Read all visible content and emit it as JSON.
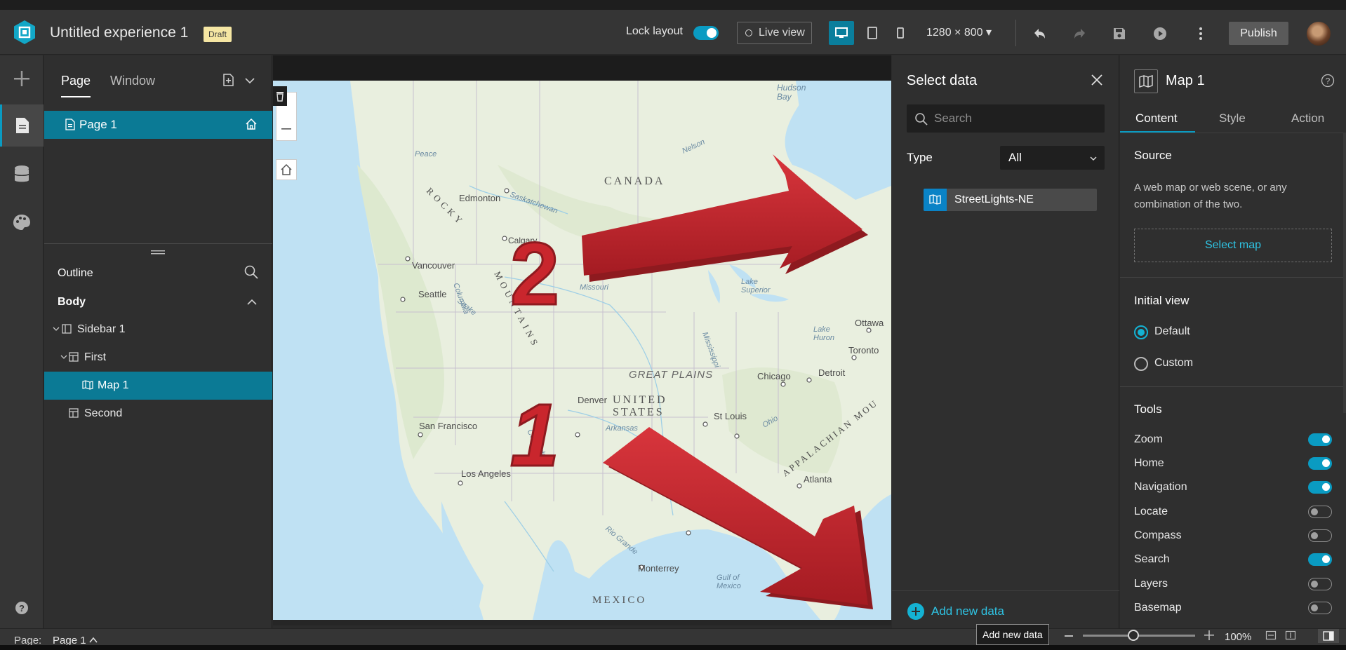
{
  "header": {
    "app_title": "Untitled experience 1",
    "draft_badge": "Draft",
    "lock_layout_label": "Lock layout",
    "lock_layout_on": true,
    "live_view_label": "Live view",
    "resolution": "1280 × 800",
    "publish_label": "Publish",
    "brand_color": "#0a9bc2"
  },
  "left_rail": {
    "icons": [
      "plus-icon",
      "page-icon",
      "data-icon",
      "theme-icon",
      "help-icon"
    ]
  },
  "page_panel": {
    "tabs": [
      "Page",
      "Window"
    ],
    "pages": [
      {
        "label": "Page 1",
        "is_home": true
      }
    ],
    "outline_title": "Outline",
    "body_label": "Body",
    "tree": [
      "Sidebar 1",
      "First",
      "Map 1",
      "Second"
    ]
  },
  "map": {
    "labels": {
      "hudson_bay": "Hudson\nBay",
      "canada": "CANADA",
      "edmonton": "Edmonton",
      "calgary": "Calgary",
      "vancouver": "Vancouver",
      "seattle": "Seattle",
      "rocky": "ROCKY",
      "mountains": "MOUNTAINS",
      "missouri": "Missouri",
      "lake_superior": "Lake\nSuperior",
      "lake_huron": "Lake\nHuron",
      "ottawa": "Ottawa",
      "toronto": "Toronto",
      "detroit": "Detroit",
      "chicago": "Chicago",
      "great_plains": "GREAT PLAINS",
      "denver": "Denver",
      "united_states": "UNITED\nSTATES",
      "st_louis": "St Louis",
      "san_francisco": "San Francisco",
      "los_angeles": "Los Angeles",
      "appalachian": "APPALACHIAN MOU",
      "atlanta": "Atlanta",
      "monterrey": "Monterrey",
      "gulf_of_mexico": "Gulf of\nMexico",
      "mexico": "MEXICO",
      "nelson": "Nelson",
      "peace": "Peace",
      "saskatchewan": "Saskatchewan",
      "arkansas": "Arkansas",
      "rio_grande": "Rio Grande",
      "colorado": "Colorado",
      "snake": "Snake",
      "columbia": "Columbia",
      "mississippi": "Mississippi",
      "ohio": "Ohio"
    },
    "annotations": [
      "1",
      "2"
    ]
  },
  "select_data": {
    "title": "Select data",
    "search_placeholder": "Search",
    "type_label": "Type",
    "type_value": "All",
    "datasets": [
      {
        "label": "StreetLights-NE"
      }
    ],
    "add_new_data": "Add new data"
  },
  "settings": {
    "widget_title": "Map 1",
    "tabs": [
      "Content",
      "Style",
      "Action"
    ],
    "source_title": "Source",
    "source_desc": "A web map or web scene, or any combination of the two.",
    "select_map": "Select map",
    "initial_view_title": "Initial view",
    "view_options": [
      {
        "label": "Default",
        "selected": true
      },
      {
        "label": "Custom",
        "selected": false
      }
    ],
    "tools_title": "Tools",
    "tools": [
      {
        "label": "Zoom",
        "on": true
      },
      {
        "label": "Home",
        "on": true
      },
      {
        "label": "Navigation",
        "on": true
      },
      {
        "label": "Locate",
        "on": false
      },
      {
        "label": "Compass",
        "on": false
      },
      {
        "label": "Search",
        "on": true
      },
      {
        "label": "Layers",
        "on": false
      },
      {
        "label": "Basemap",
        "on": false
      }
    ]
  },
  "status_bar": {
    "page_label": "Page:",
    "page_value": "Page 1",
    "tooltip": "Add new data",
    "zoom_level": "100%",
    "zoom_fraction": 0.45
  }
}
